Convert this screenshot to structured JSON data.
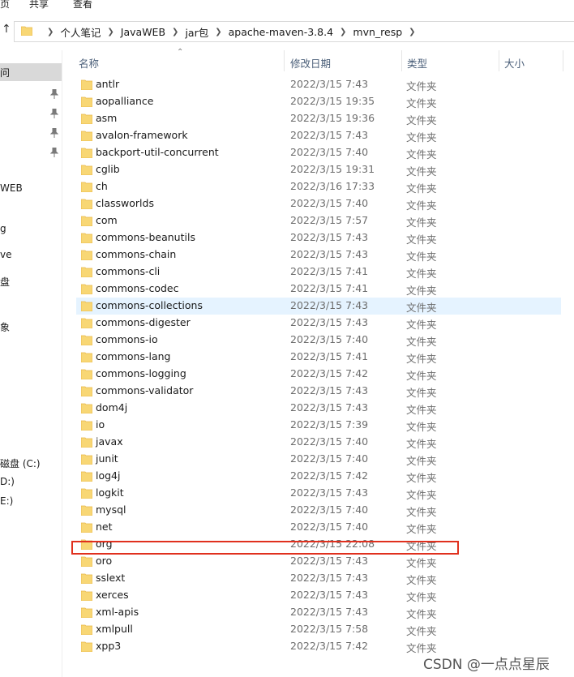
{
  "ribbon": {
    "tabs": [
      "页",
      "共享",
      "查看"
    ]
  },
  "address": {
    "crumbs": [
      "个人笔记",
      "JavaWEB",
      "jar包",
      "apache-maven-3.8.4",
      "mvn_resp"
    ]
  },
  "nav": {
    "items": [
      "问",
      "WEB",
      "g",
      "ve",
      "盘",
      "象",
      "磁盘 (C:)",
      "D:)",
      "E:)"
    ]
  },
  "columns": {
    "name": "名称",
    "date": "修改日期",
    "type": "类型",
    "size": "大小"
  },
  "files": [
    {
      "name": "antlr",
      "date": "2022/3/15 7:43",
      "type": "文件夹"
    },
    {
      "name": "aopalliance",
      "date": "2022/3/15 19:35",
      "type": "文件夹"
    },
    {
      "name": "asm",
      "date": "2022/3/15 19:36",
      "type": "文件夹"
    },
    {
      "name": "avalon-framework",
      "date": "2022/3/15 7:43",
      "type": "文件夹"
    },
    {
      "name": "backport-util-concurrent",
      "date": "2022/3/15 7:40",
      "type": "文件夹"
    },
    {
      "name": "cglib",
      "date": "2022/3/15 19:31",
      "type": "文件夹"
    },
    {
      "name": "ch",
      "date": "2022/3/16 17:33",
      "type": "文件夹"
    },
    {
      "name": "classworlds",
      "date": "2022/3/15 7:40",
      "type": "文件夹"
    },
    {
      "name": "com",
      "date": "2022/3/15 7:57",
      "type": "文件夹"
    },
    {
      "name": "commons-beanutils",
      "date": "2022/3/15 7:43",
      "type": "文件夹"
    },
    {
      "name": "commons-chain",
      "date": "2022/3/15 7:43",
      "type": "文件夹"
    },
    {
      "name": "commons-cli",
      "date": "2022/3/15 7:41",
      "type": "文件夹"
    },
    {
      "name": "commons-codec",
      "date": "2022/3/15 7:41",
      "type": "文件夹"
    },
    {
      "name": "commons-collections",
      "date": "2022/3/15 7:43",
      "type": "文件夹"
    },
    {
      "name": "commons-digester",
      "date": "2022/3/15 7:43",
      "type": "文件夹"
    },
    {
      "name": "commons-io",
      "date": "2022/3/15 7:40",
      "type": "文件夹"
    },
    {
      "name": "commons-lang",
      "date": "2022/3/15 7:41",
      "type": "文件夹"
    },
    {
      "name": "commons-logging",
      "date": "2022/3/15 7:42",
      "type": "文件夹"
    },
    {
      "name": "commons-validator",
      "date": "2022/3/15 7:43",
      "type": "文件夹"
    },
    {
      "name": "dom4j",
      "date": "2022/3/15 7:43",
      "type": "文件夹"
    },
    {
      "name": "io",
      "date": "2022/3/15 7:39",
      "type": "文件夹"
    },
    {
      "name": "javax",
      "date": "2022/3/15 7:40",
      "type": "文件夹"
    },
    {
      "name": "junit",
      "date": "2022/3/15 7:40",
      "type": "文件夹"
    },
    {
      "name": "log4j",
      "date": "2022/3/15 7:42",
      "type": "文件夹"
    },
    {
      "name": "logkit",
      "date": "2022/3/15 7:43",
      "type": "文件夹"
    },
    {
      "name": "mysql",
      "date": "2022/3/15 7:40",
      "type": "文件夹"
    },
    {
      "name": "net",
      "date": "2022/3/15 7:40",
      "type": "文件夹"
    },
    {
      "name": "org",
      "date": "2022/3/15 22:08",
      "type": "文件夹"
    },
    {
      "name": "oro",
      "date": "2022/3/15 7:43",
      "type": "文件夹"
    },
    {
      "name": "sslext",
      "date": "2022/3/15 7:43",
      "type": "文件夹"
    },
    {
      "name": "xerces",
      "date": "2022/3/15 7:43",
      "type": "文件夹"
    },
    {
      "name": "xml-apis",
      "date": "2022/3/15 7:43",
      "type": "文件夹"
    },
    {
      "name": "xmlpull",
      "date": "2022/3/15 7:58",
      "type": "文件夹"
    },
    {
      "name": "xpp3",
      "date": "2022/3/15 7:42",
      "type": "文件夹"
    }
  ],
  "hover_row": "commons-collections",
  "boxed_row": "org",
  "watermark": "CSDN @一点点星辰",
  "colors": {
    "folder": "#f8d775",
    "folder_dark": "#e8b84a",
    "hover": "#e5f3ff",
    "redbox": "#e0301e"
  }
}
